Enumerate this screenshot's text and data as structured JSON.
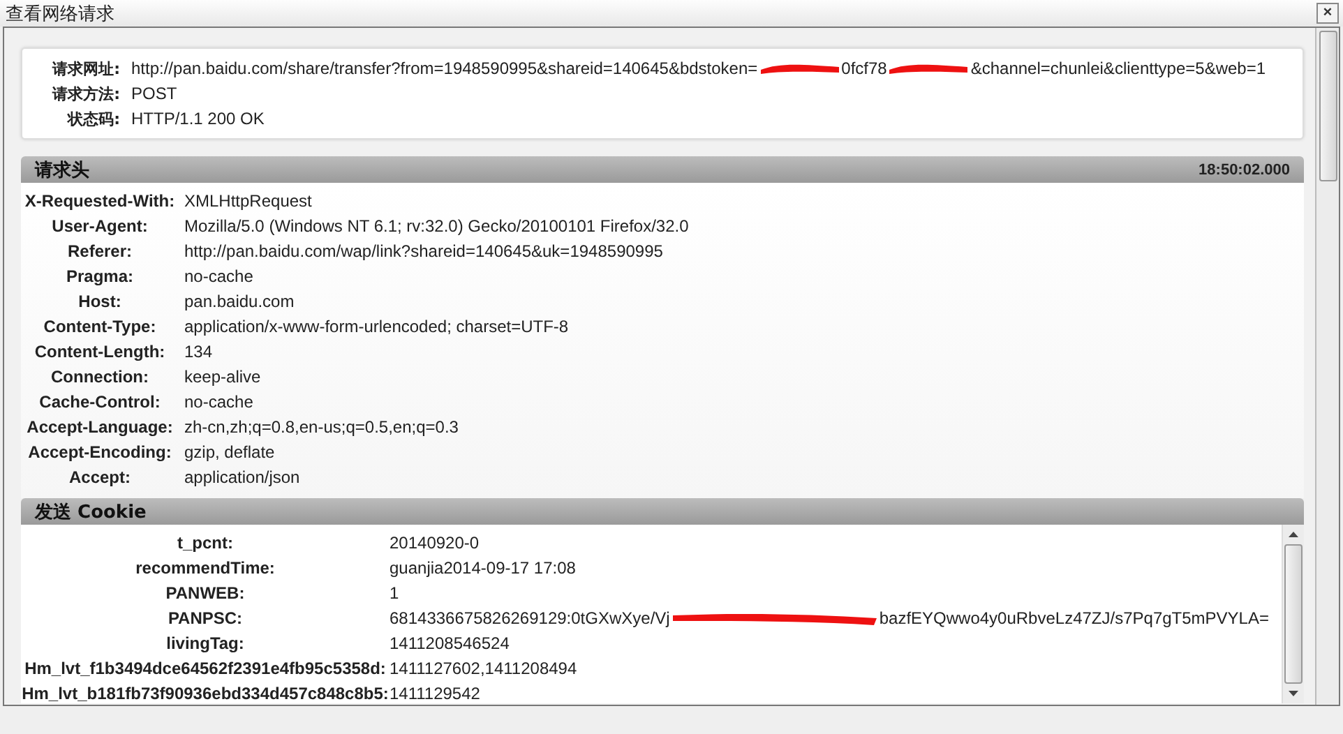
{
  "window": {
    "title": "查看网络请求",
    "close": "×"
  },
  "summary": [
    {
      "label": "请求网址:",
      "segments": [
        {
          "kind": "text",
          "text": "http://pan.baidu.com/share/transfer?from=1948590995&shareid=140645&bdstoken="
        },
        {
          "kind": "redaction"
        },
        {
          "kind": "text",
          "text": "0fcf78"
        },
        {
          "kind": "redaction"
        },
        {
          "kind": "text",
          "text": "&channel=chunlei&clienttype=5&web=1"
        }
      ]
    },
    {
      "label": "请求方法:",
      "segments": [
        {
          "kind": "text",
          "text": "POST"
        }
      ]
    },
    {
      "label": "状态码:",
      "segments": [
        {
          "kind": "text",
          "text": "HTTP/1.1 200 OK"
        }
      ]
    }
  ],
  "request_headers": {
    "title": "请求头",
    "time": "18:50:02.000",
    "rows": [
      {
        "name": "X-Requested-With:",
        "value": "XMLHttpRequest"
      },
      {
        "name": "User-Agent:",
        "value": "Mozilla/5.0 (Windows NT 6.1; rv:32.0) Gecko/20100101 Firefox/32.0"
      },
      {
        "name": "Referer:",
        "value": "http://pan.baidu.com/wap/link?shareid=140645&uk=1948590995"
      },
      {
        "name": "Pragma:",
        "value": "no-cache"
      },
      {
        "name": "Host:",
        "value": "pan.baidu.com"
      },
      {
        "name": "Content-Type:",
        "value": "application/x-www-form-urlencoded; charset=UTF-8"
      },
      {
        "name": "Content-Length:",
        "value": "134"
      },
      {
        "name": "Connection:",
        "value": "keep-alive"
      },
      {
        "name": "Cache-Control:",
        "value": "no-cache"
      },
      {
        "name": "Accept-Language:",
        "value": "zh-cn,zh;q=0.8,en-us;q=0.5,en;q=0.3"
      },
      {
        "name": "Accept-Encoding:",
        "value": "gzip, deflate"
      },
      {
        "name": "Accept:",
        "value": "application/json"
      }
    ]
  },
  "cookies": {
    "title": "发送 Cookie",
    "rows": [
      {
        "name": "t_pcnt:",
        "segments": [
          {
            "kind": "text",
            "text": "20140920-0"
          }
        ]
      },
      {
        "name": "recommendTime:",
        "segments": [
          {
            "kind": "text",
            "text": "guanjia2014-09-17 17:08"
          }
        ]
      },
      {
        "name": "PANWEB:",
        "segments": [
          {
            "kind": "text",
            "text": "1"
          }
        ]
      },
      {
        "name": "PANPSC:",
        "segments": [
          {
            "kind": "text",
            "text": "6814336675826269129:0tGXwXye/Vj"
          },
          {
            "kind": "redaction"
          },
          {
            "kind": "text",
            "text": "bazfEYQwwo4y0uRbveLz47ZJ/s7Pq7gT5mPVYLA="
          }
        ]
      },
      {
        "name": "livingTag:",
        "segments": [
          {
            "kind": "text",
            "text": "1411208546524"
          }
        ]
      },
      {
        "name": "Hm_lvt_f1b3494dce64562f2391e4fb95c5358d:",
        "segments": [
          {
            "kind": "text",
            "text": "1411127602,1411208494"
          }
        ]
      },
      {
        "name": "Hm_lvt_b181fb73f90936ebd334d457c848c8b5:",
        "segments": [
          {
            "kind": "text",
            "text": "1411129542"
          }
        ]
      }
    ]
  }
}
